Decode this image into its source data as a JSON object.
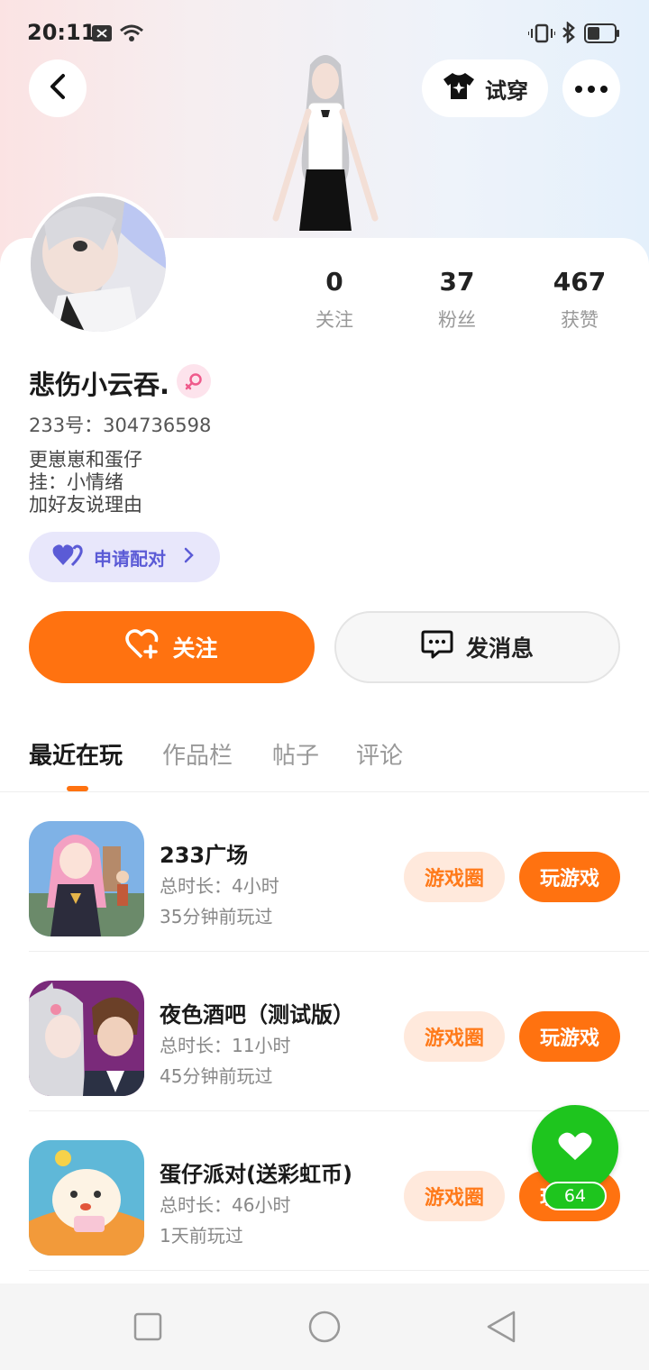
{
  "status": {
    "time": "20:11"
  },
  "header": {
    "tryon_label": "试穿"
  },
  "stats": [
    {
      "value": "0",
      "label": "关注"
    },
    {
      "value": "37",
      "label": "粉丝"
    },
    {
      "value": "467",
      "label": "获赞"
    }
  ],
  "profile": {
    "name": "悲伤小云吞.",
    "uid": "233号：304736598",
    "bio": [
      "更崽崽和蛋仔",
      "挂：小情绪",
      "加好友说理由"
    ],
    "pair_label": "申请配对"
  },
  "actions": {
    "follow_label": "关注",
    "message_label": "发消息"
  },
  "tabs": [
    "最近在玩",
    "作品栏",
    "帖子",
    "评论"
  ],
  "games": [
    {
      "title": "233广场",
      "duration": "总时长：4小时",
      "last_played": "35分钟前玩过",
      "circle_label": "游戏圈",
      "play_label": "玩游戏"
    },
    {
      "title": "夜色酒吧（测试版）",
      "duration": "总时长：11小时",
      "last_played": "45分钟前玩过",
      "circle_label": "游戏圈",
      "play_label": "玩游戏"
    },
    {
      "title": "蛋仔派对(送彩虹币)",
      "duration": "总时长：46小时",
      "last_played": "1天前玩过",
      "circle_label": "游戏圈",
      "play_label": "玩游戏"
    }
  ],
  "fab": {
    "count": "64"
  },
  "colors": {
    "accent": "#ff7210",
    "fab": "#1ec51e",
    "pair": "#5b5bd6"
  }
}
